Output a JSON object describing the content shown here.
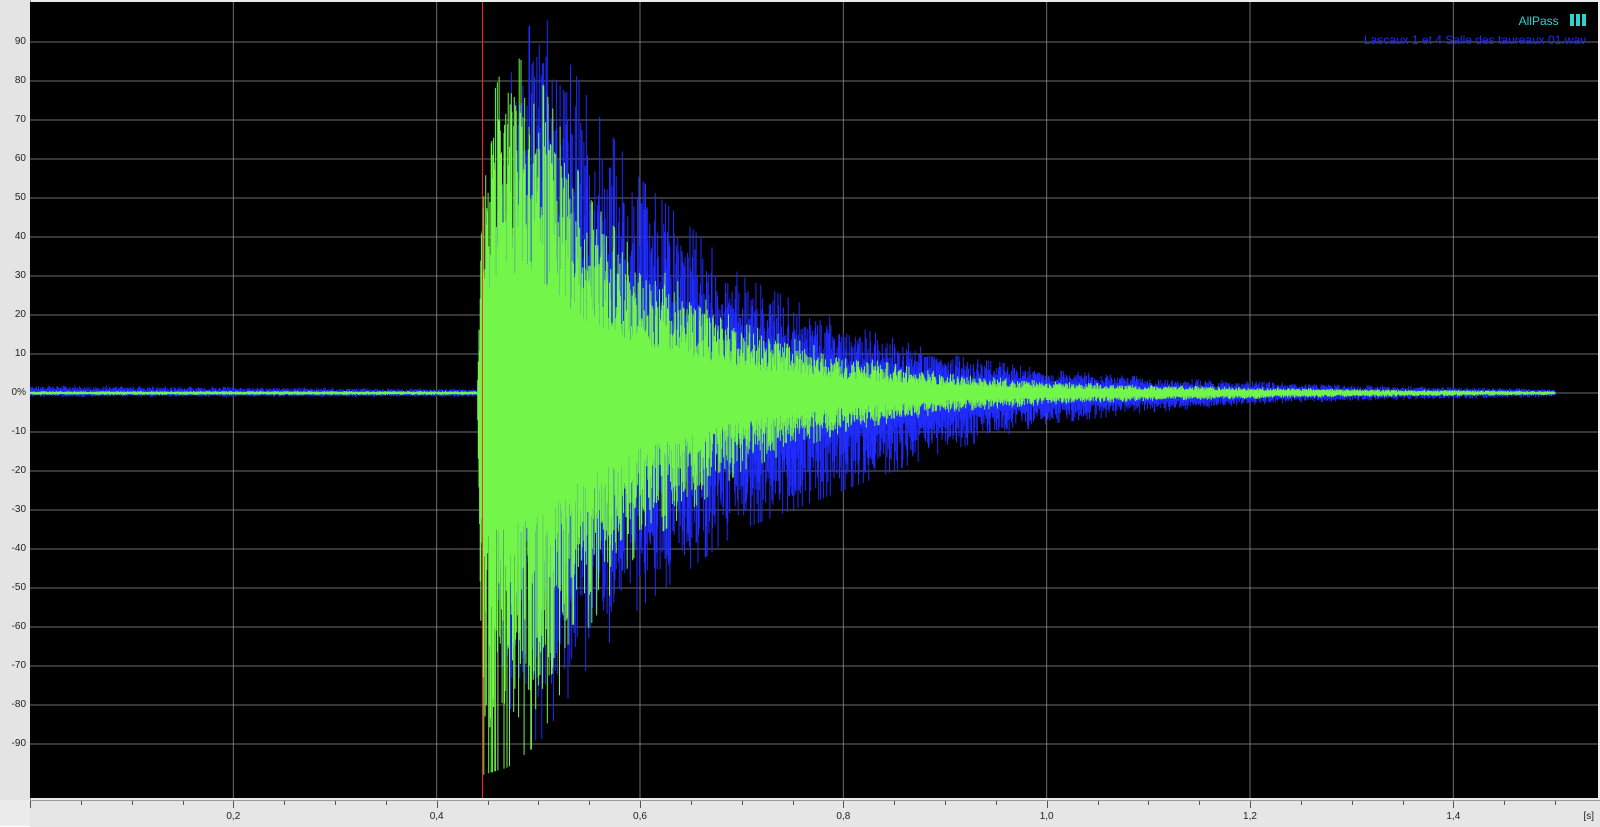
{
  "chart_data": {
    "type": "line",
    "title": "",
    "xlabel": "",
    "ylabel": "",
    "x_unit": "[s]",
    "xlim": [
      0,
      1.5
    ],
    "ylim": [
      -100,
      100
    ],
    "grid": true,
    "legend_position": "top-right",
    "x_ticks": [
      "0,2",
      "0,4",
      "0,6",
      "0,8",
      "1,0",
      "1,2",
      "1,4"
    ],
    "x_tick_values": [
      0.2,
      0.4,
      0.6,
      0.8,
      1.0,
      1.2,
      1.4
    ],
    "y_ticks": [
      "90",
      "80",
      "70",
      "60",
      "50",
      "40",
      "30",
      "20",
      "10",
      "0%",
      "-10",
      "-20",
      "-30",
      "-40",
      "-50",
      "-60",
      "-70",
      "-80",
      "-90"
    ],
    "y_tick_values": [
      90,
      80,
      70,
      60,
      50,
      40,
      30,
      20,
      10,
      0,
      -10,
      -20,
      -30,
      -40,
      -50,
      -60,
      -70,
      -80,
      -90
    ],
    "marker_x": 0.445,
    "series": [
      {
        "name": "Lascaux 1 et 4 Salle des taureaux 01.wav",
        "color": "#1f2bff",
        "envelope": {
          "x": [
            0.0,
            0.44,
            0.445,
            0.47,
            0.5,
            0.55,
            0.6,
            0.7,
            0.8,
            0.9,
            1.0,
            1.1,
            1.2,
            1.3,
            1.5
          ],
          "upper": [
            2,
            1,
            30,
            80,
            100,
            75,
            55,
            30,
            18,
            10,
            6,
            4,
            3,
            2,
            1
          ],
          "lower": [
            -1,
            -1,
            -30,
            -80,
            -90,
            -70,
            -55,
            -35,
            -25,
            -15,
            -8,
            -5,
            -3,
            -2,
            -1
          ]
        }
      },
      {
        "name": "AllPass",
        "color": "#73f54a",
        "envelope": {
          "x": [
            0.0,
            0.44,
            0.445,
            0.47,
            0.5,
            0.55,
            0.6,
            0.7,
            0.8,
            0.9,
            1.0,
            1.1,
            1.2,
            1.3,
            1.5
          ],
          "upper": [
            0.5,
            0.5,
            68,
            88,
            82,
            50,
            35,
            18,
            10,
            5,
            3,
            2,
            1.5,
            1,
            0.5
          ],
          "lower": [
            -0.5,
            -0.5,
            -98,
            -96,
            -90,
            -60,
            -40,
            -20,
            -10,
            -5,
            -3,
            -2,
            -1.5,
            -1,
            -0.5
          ]
        }
      }
    ]
  },
  "colors": {
    "plot_bg": "#000000",
    "grid": "#9a9a9a",
    "marker": "#ff2a2a",
    "legend_allpass": "#2fd1d1",
    "legend_file": "#1f2bff"
  },
  "legend": {
    "allpass_label": "AllPass",
    "file_label": "Lascaux 1 et 4 Salle des taureaux 01.wav"
  }
}
